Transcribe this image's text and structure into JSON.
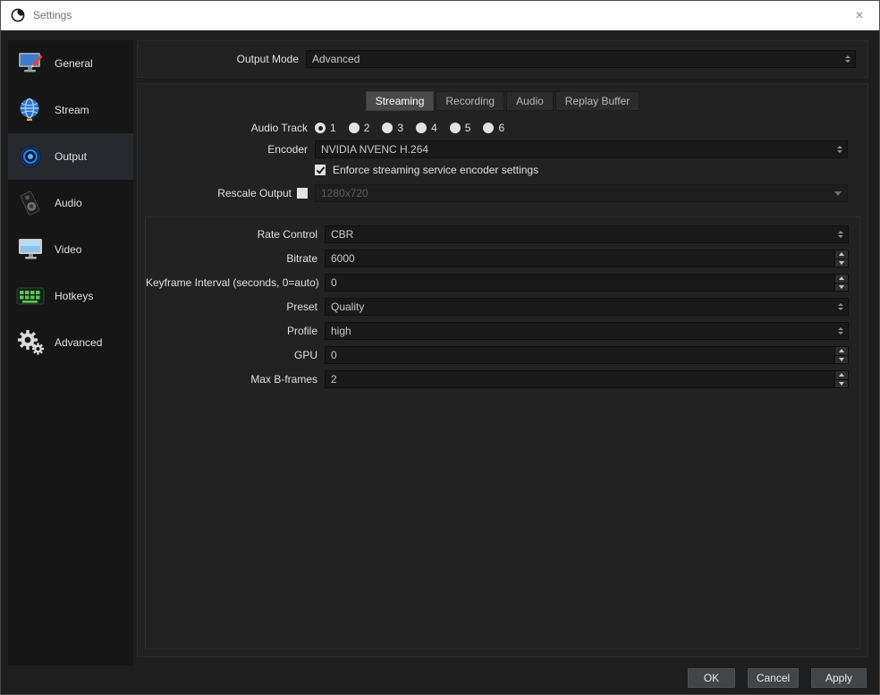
{
  "colors": {
    "titlebar_bg": "#ffffff",
    "window_bg": "#1e1e1e",
    "panel_bg": "#222222",
    "sidebar_bg": "#161616",
    "field_bg": "#191919",
    "accent_blue": "#2f7fe0"
  },
  "titlebar": {
    "title": "Settings",
    "close_glyph": "×"
  },
  "sidebar": {
    "items": [
      {
        "label": "General",
        "selected": false
      },
      {
        "label": "Stream",
        "selected": false
      },
      {
        "label": "Output",
        "selected": true
      },
      {
        "label": "Audio",
        "selected": false
      },
      {
        "label": "Video",
        "selected": false
      },
      {
        "label": "Hotkeys",
        "selected": false
      },
      {
        "label": "Advanced",
        "selected": false
      }
    ]
  },
  "output_mode": {
    "label": "Output Mode",
    "value": "Advanced"
  },
  "tabs": [
    {
      "label": "Streaming",
      "active": true
    },
    {
      "label": "Recording",
      "active": false
    },
    {
      "label": "Audio",
      "active": false
    },
    {
      "label": "Replay Buffer",
      "active": false
    }
  ],
  "streaming": {
    "audio_track": {
      "label": "Audio Track",
      "options": [
        "1",
        "2",
        "3",
        "4",
        "5",
        "6"
      ],
      "selected": "1"
    },
    "encoder": {
      "label": "Encoder",
      "value": "NVIDIA NVENC H.264"
    },
    "enforce_checkbox": {
      "label": "Enforce streaming service encoder settings",
      "checked": true
    },
    "rescale": {
      "label": "Rescale Output",
      "checked": false,
      "value": "1280x720",
      "disabled": true
    },
    "fields": [
      {
        "label": "Rate Control",
        "value": "CBR",
        "control": "combo"
      },
      {
        "label": "Bitrate",
        "value": "6000",
        "control": "spinbox"
      },
      {
        "label": "Keyframe Interval (seconds, 0=auto)",
        "value": "0",
        "control": "spinbox"
      },
      {
        "label": "Preset",
        "value": "Quality",
        "control": "combo"
      },
      {
        "label": "Profile",
        "value": "high",
        "control": "combo"
      },
      {
        "label": "GPU",
        "value": "0",
        "control": "spinbox"
      },
      {
        "label": "Max B-frames",
        "value": "2",
        "control": "spinbox"
      }
    ]
  },
  "footer": {
    "ok": "OK",
    "cancel": "Cancel",
    "apply": "Apply"
  }
}
